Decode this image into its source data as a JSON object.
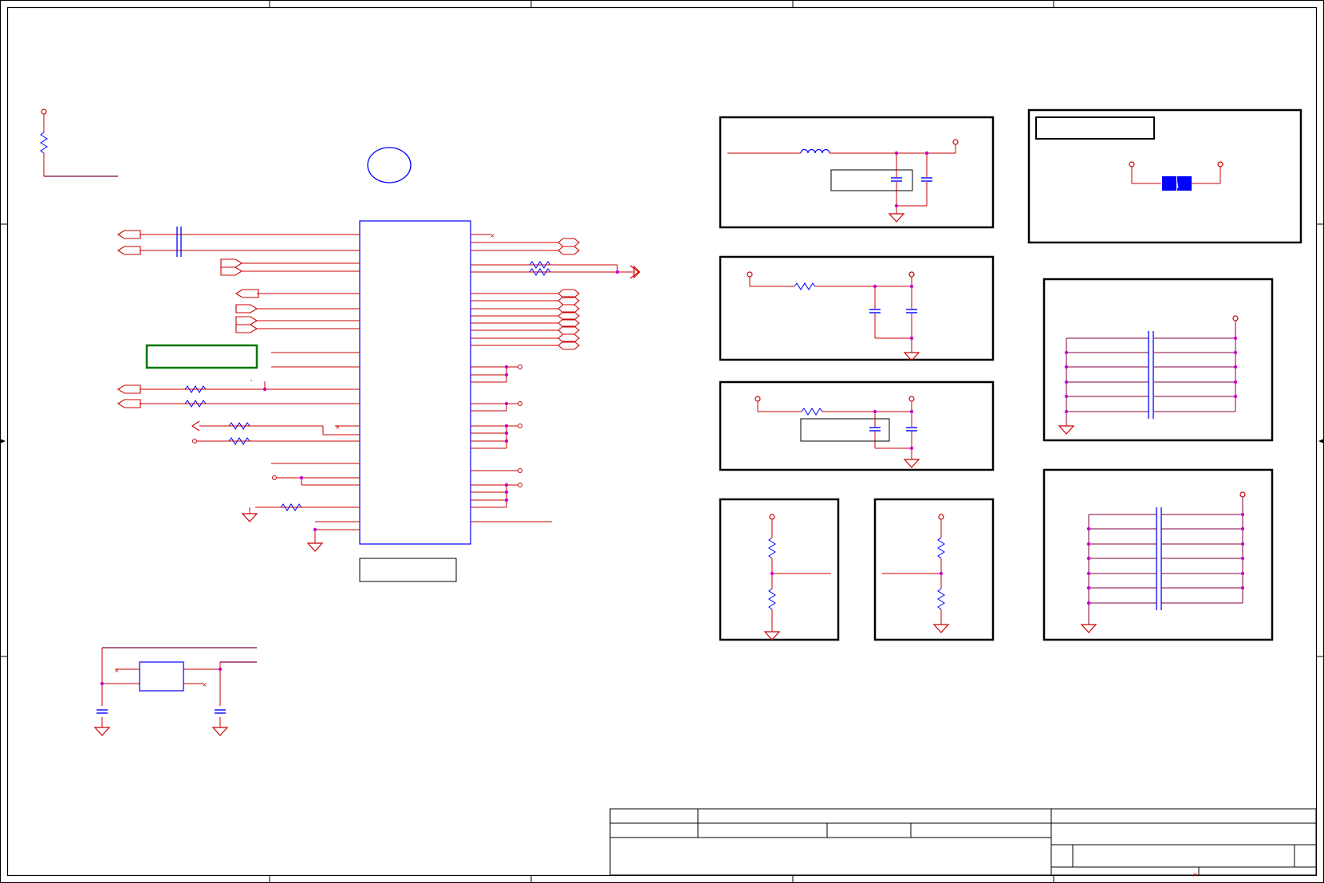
{
  "sheet": {
    "background": "#ffffff",
    "border_color": "#000000",
    "wire_color": "#cc0000",
    "net_color": "#800040",
    "component_color": "#0000ff",
    "junction_color": "#cc00cc",
    "highlight_box_color": "#007700"
  },
  "annotations": {
    "no_connect_marks": [
      "×",
      "×",
      "×",
      "×",
      "×"
    ],
    "tick_mark": "'"
  },
  "title_block": {
    "cells": []
  }
}
